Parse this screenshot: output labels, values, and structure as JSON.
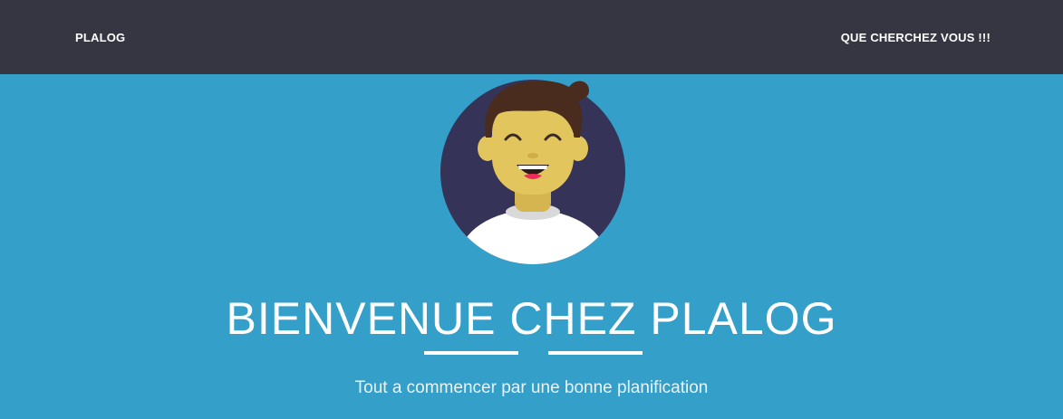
{
  "navbar": {
    "brand": "PLALOG",
    "link": "QUE CHERCHEZ VOUS !!!"
  },
  "hero": {
    "title": "BIENVENUE CHEZ PLALOG",
    "subtitle": "Tout a commencer par une bonne planification",
    "avatar_icon": "smiling-man-avatar"
  },
  "colors": {
    "navbar_bg": "#363643",
    "hero_bg": "#349fc8",
    "avatar_circle": "#363358",
    "skin": "#e3c55d",
    "hair": "#4a2c1f"
  }
}
